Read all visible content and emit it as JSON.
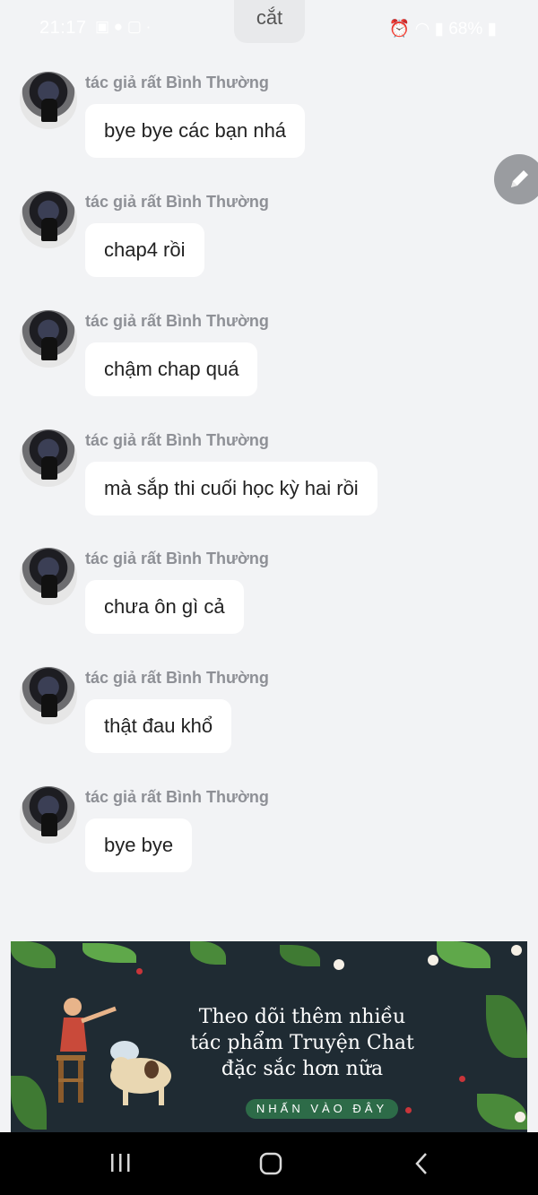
{
  "status_bar": {
    "time": "21:17",
    "battery": "68%",
    "icons": [
      "gallery-icon",
      "messenger-icon",
      "app-icon",
      "dot-icon",
      "alarm-icon",
      "wifi-icon",
      "signal-icon",
      "battery-icon"
    ]
  },
  "copy_chip": {
    "label": "cắt"
  },
  "messages": [
    {
      "author": "tác giả rất Bình Thường",
      "text": "bye bye các bạn nhá"
    },
    {
      "author": "tác giả rất Bình Thường",
      "text": "chap4 rồi"
    },
    {
      "author": "tác giả rất Bình Thường",
      "text": "chậm chap quá"
    },
    {
      "author": "tác giả rất Bình Thường",
      "text": "mà sắp thi cuối học kỳ hai rồi"
    },
    {
      "author": "tác giả rất Bình Thường",
      "text": "chưa ôn gì cả"
    },
    {
      "author": "tác giả rất Bình Thường",
      "text": "thật đau khổ"
    },
    {
      "author": "tác giả rất Bình Thường",
      "text": "bye bye"
    }
  ],
  "banner": {
    "text": "Theo dõi thêm nhiều tác phẩm Truyện Chat đặc sắc hơn nữa",
    "button": "NHẤN VÀO ĐÂY"
  },
  "nav": {
    "items": [
      "recent-apps-icon",
      "home-icon",
      "back-icon"
    ]
  },
  "colors": {
    "background": "#f2f3f5",
    "bubble": "#ffffff",
    "author": "#8e9096",
    "banner_bg": "#1f2b33",
    "banner_button": "#2d6b48"
  }
}
